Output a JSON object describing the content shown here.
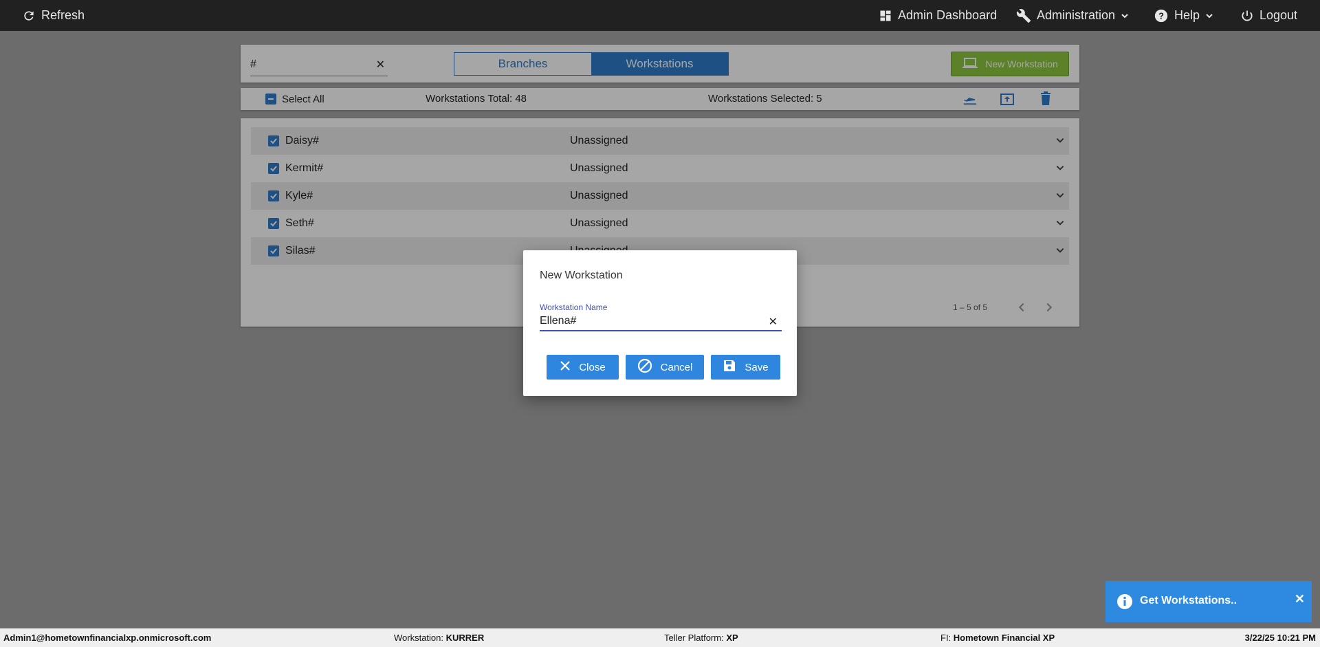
{
  "topbar": {
    "refresh": "Refresh",
    "admin_dashboard": "Admin Dashboard",
    "administration": "Administration",
    "help": "Help",
    "logout": "Logout"
  },
  "search": {
    "value": "#"
  },
  "view_toggle": {
    "branches": "Branches",
    "workstations": "Workstations",
    "active": "Workstations"
  },
  "new_workstation_button": "New Workstation",
  "selection_bar": {
    "select_all": "Select All",
    "total": "Workstations Total: 48",
    "selected": "Workstations Selected: 5"
  },
  "workstations": [
    {
      "name": "Daisy#",
      "status": "Unassigned",
      "checked": true
    },
    {
      "name": "Kermit#",
      "status": "Unassigned",
      "checked": true
    },
    {
      "name": "Kyle#",
      "status": "Unassigned",
      "checked": true
    },
    {
      "name": "Seth#",
      "status": "Unassigned",
      "checked": true
    },
    {
      "name": "Silas#",
      "status": "Unassigned",
      "checked": true
    }
  ],
  "pagination": {
    "range": "1 – 5 of 5"
  },
  "modal": {
    "title": "New Workstation",
    "field_label": "Workstation Name",
    "field_value": "Ellena#",
    "close": "Close",
    "cancel": "Cancel",
    "save": "Save"
  },
  "toast": {
    "message": "Get Workstations.."
  },
  "statusbar": {
    "user": "Admin1@hometownfinancialxp.onmicrosoft.com",
    "workstation_label": "Workstation: ",
    "workstation_value": "KURRER",
    "platform_label": "Teller Platform: ",
    "platform_value": "XP",
    "fi_label": "FI: ",
    "fi_value": "Hometown Financial XP",
    "datetime": "3/22/25 10:21 PM"
  },
  "colors": {
    "accent": "#2e7bc9",
    "new_button": "#8dc63f",
    "topbar": "#212121",
    "toast": "#2e8ae0"
  }
}
